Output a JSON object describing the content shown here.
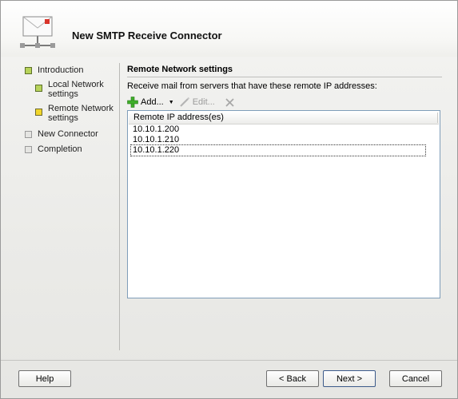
{
  "window": {
    "title": "New SMTP Receive Connector"
  },
  "nav": {
    "items": [
      {
        "label": "Introduction",
        "state": "done"
      },
      {
        "label": "Local Network settings",
        "line1": "Local Network",
        "line2": "settings",
        "state": "done"
      },
      {
        "label": "Remote Network settings",
        "line1": "Remote Network",
        "line2": "settings",
        "state": "current"
      },
      {
        "label": "New Connector",
        "state": "pending"
      },
      {
        "label": "Completion",
        "state": "pending"
      }
    ]
  },
  "main": {
    "section_title": "Remote Network settings",
    "description": "Receive mail from servers that have these remote IP addresses:",
    "toolbar": {
      "add_label": "Add...",
      "edit_label": "Edit...",
      "remove_icon": "delete-x-icon"
    },
    "list": {
      "column_header": "Remote IP address(es)",
      "rows": [
        "10.10.1.200",
        "10.10.1.210",
        "10.10.1.220"
      ]
    }
  },
  "footer": {
    "help_label": "Help",
    "back_label": "< Back",
    "next_label": "Next >",
    "cancel_label": "Cancel"
  },
  "colors": {
    "current_step": "#f1d62a",
    "done_step": "#b7d35a",
    "pending_step": "#e5e5e2",
    "list_border": "#7f9db9",
    "add_icon": "#3fae2a"
  }
}
